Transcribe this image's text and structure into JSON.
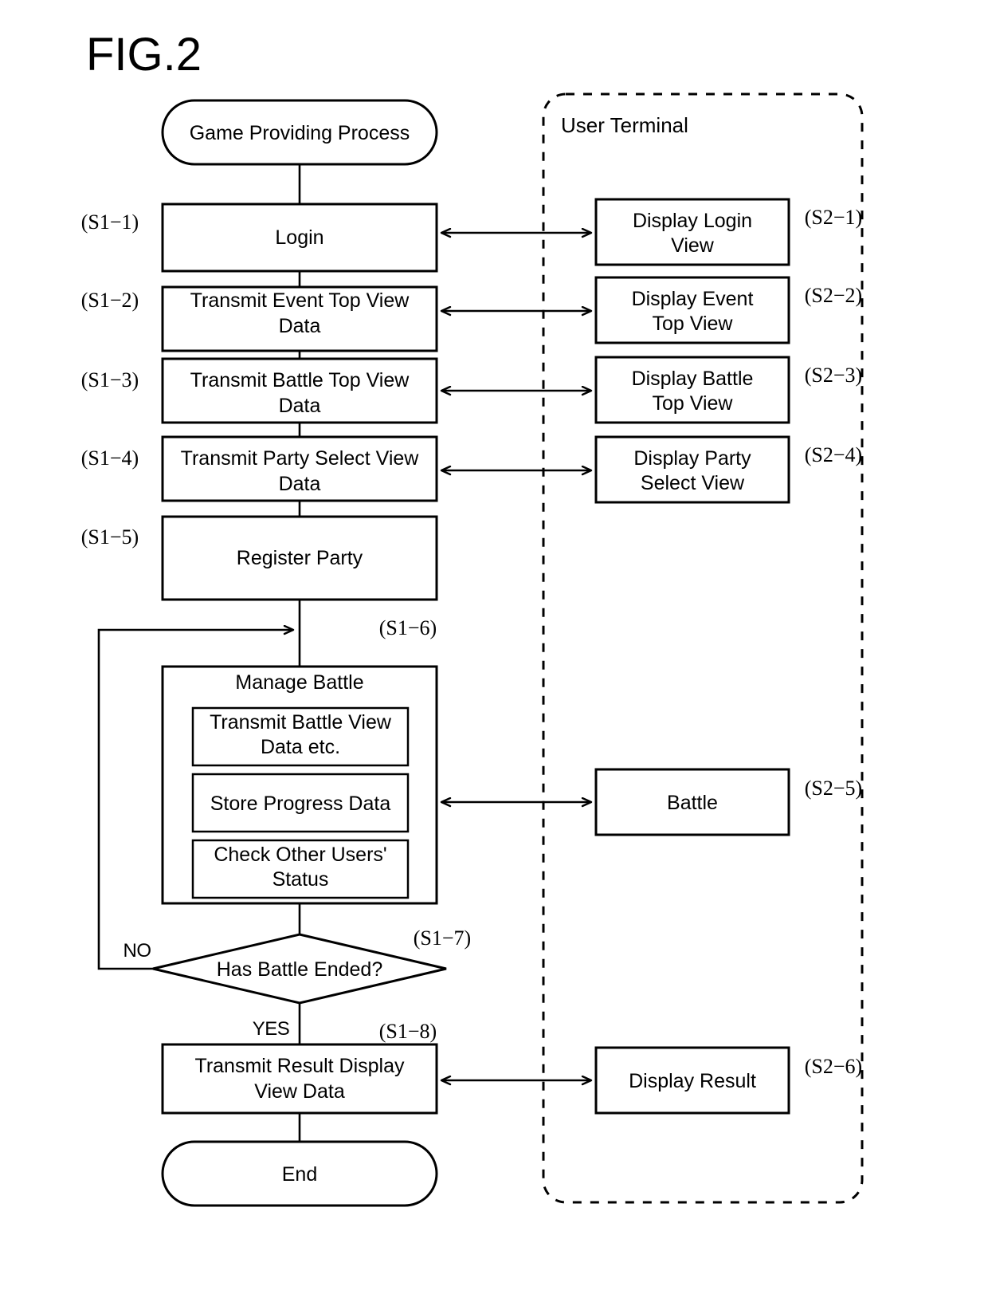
{
  "figure": {
    "title": "FIG.2"
  },
  "lane": {
    "title": "User Terminal"
  },
  "server_flow": {
    "start": {
      "label": "Game Providing Process"
    },
    "end": {
      "label": "End"
    },
    "steps": [
      {
        "id": "S1-1",
        "step": "(S1−1)",
        "label": "Login"
      },
      {
        "id": "S1-2",
        "step": "(S1−2)",
        "label_line1": "Transmit Event Top View",
        "label_line2": "Data"
      },
      {
        "id": "S1-3",
        "step": "(S1−3)",
        "label_line1": "Transmit Battle Top View",
        "label_line2": "Data"
      },
      {
        "id": "S1-4",
        "step": "(S1−4)",
        "label_line1": "Transmit Party Select View",
        "label_line2": "Data"
      },
      {
        "id": "S1-5",
        "step": "(S1−5)",
        "label": "Register Party"
      },
      {
        "id": "S1-6",
        "step": "(S1−6)",
        "label": "Manage Battle"
      },
      {
        "id": "S1-7",
        "step": "(S1−7)",
        "label": "Has Battle Ended?"
      },
      {
        "id": "S1-8",
        "step": "(S1−8)",
        "label_line1": "Transmit Result Display",
        "label_line2": "View Data"
      }
    ],
    "manage_battle_substeps": [
      {
        "label_line1": "Transmit Battle View",
        "label_line2": "Data etc."
      },
      {
        "label_line1": "Store Progress Data",
        "label_line2": ""
      },
      {
        "label_line1": "Check Other Users'",
        "label_line2": "Status"
      }
    ],
    "branches": {
      "no": "NO",
      "yes": "YES"
    }
  },
  "terminal_flow": {
    "steps": [
      {
        "id": "S2-1",
        "step": "(S2−1)",
        "label_line1": "Display Login",
        "label_line2": "View"
      },
      {
        "id": "S2-2",
        "step": "(S2−2)",
        "label_line1": "Display Event",
        "label_line2": "Top View"
      },
      {
        "id": "S2-3",
        "step": "(S2−3)",
        "label_line1": "Display Battle",
        "label_line2": "Top View"
      },
      {
        "id": "S2-4",
        "step": "(S2−4)",
        "label_line1": "Display Party",
        "label_line2": "Select View"
      },
      {
        "id": "S2-5",
        "step": "(S2−5)",
        "label": "Battle"
      },
      {
        "id": "S2-6",
        "step": "(S2−6)",
        "label": "Display Result"
      }
    ]
  },
  "colors": {
    "stroke": "#000000",
    "background": "#ffffff"
  }
}
